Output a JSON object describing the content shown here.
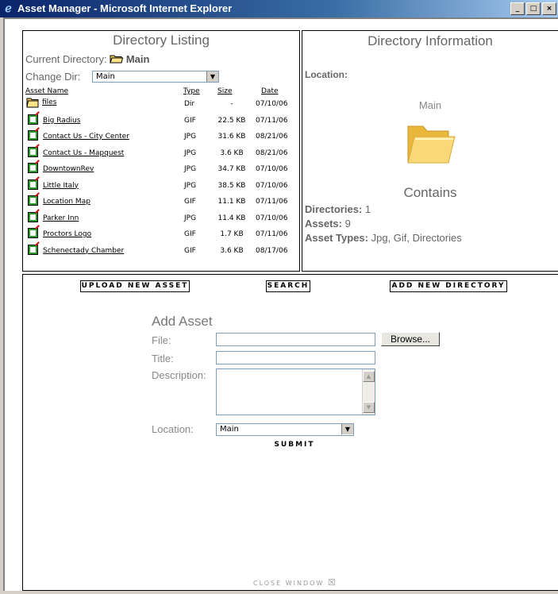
{
  "window": {
    "title": "Asset Manager - Microsoft Internet Explorer",
    "min_glyph": "_",
    "max_glyph": "□",
    "close_glyph": "×"
  },
  "listing": {
    "heading": "Directory Listing",
    "current_dir_label": "Current Directory:",
    "current_dir_value": "Main",
    "change_dir_label": "Change Dir:",
    "change_dir_value": "Main",
    "columns": {
      "name": "Asset Name",
      "type": "Type",
      "size": "Size",
      "date": "Date"
    },
    "rows": [
      {
        "name": "files",
        "type": "Dir",
        "size": "-",
        "date": "07/10/06",
        "icon": "folder-icon"
      },
      {
        "name": "Big Radius",
        "type": "GIF",
        "size": "22.5 KB",
        "date": "07/11/06",
        "icon": "asset-file-icon"
      },
      {
        "name": "Contact Us - City Center",
        "type": "JPG",
        "size": "31.6 KB",
        "date": "08/21/06",
        "icon": "asset-file-icon"
      },
      {
        "name": "Contact Us - Mapquest",
        "type": "JPG",
        "size": "3.6 KB",
        "date": "08/21/06",
        "icon": "asset-file-icon"
      },
      {
        "name": "DowntownRev",
        "type": "JPG",
        "size": "34.7 KB",
        "date": "07/10/06",
        "icon": "asset-file-icon"
      },
      {
        "name": "Little Italy",
        "type": "JPG",
        "size": "38.5 KB",
        "date": "07/10/06",
        "icon": "asset-file-icon"
      },
      {
        "name": "Location Map",
        "type": "GIF",
        "size": "11.1 KB",
        "date": "07/11/06",
        "icon": "asset-file-icon"
      },
      {
        "name": "Parker Inn",
        "type": "JPG",
        "size": "11.4 KB",
        "date": "07/10/06",
        "icon": "asset-file-icon"
      },
      {
        "name": "Proctors Logo",
        "type": "GIF",
        "size": "1.7 KB",
        "date": "07/11/06",
        "icon": "asset-file-icon"
      },
      {
        "name": "Schenectady Chamber",
        "type": "GIF",
        "size": "3.6 KB",
        "date": "08/17/06",
        "icon": "asset-file-icon"
      }
    ]
  },
  "info": {
    "heading": "Directory Information",
    "location_label": "Location:",
    "folder_name": "Main",
    "contains_heading": "Contains",
    "directories_label": "Directories:",
    "directories_value": "1",
    "assets_label": "Assets:",
    "assets_value": "9",
    "asset_types_label": "Asset Types:",
    "asset_types_value": "Jpg, Gif, Directories"
  },
  "actions": {
    "upload": "UPLOAD NEW ASSET",
    "search": "SEARCH",
    "add_dir": "ADD NEW DIRECTORY"
  },
  "form": {
    "heading": "Add Asset",
    "file_label": "File:",
    "title_label": "Title:",
    "description_label": "Description:",
    "location_label": "Location:",
    "location_value": "Main",
    "browse_label": "Browse...",
    "submit_label": "SUBMIT"
  },
  "footer": {
    "close_label": "CLOSE WINDOW",
    "close_glyph": "☒"
  },
  "colors": {
    "titlebar": "#0a246a",
    "folder": "#f4cf5a",
    "asset_icon": "#2a9a2a"
  }
}
